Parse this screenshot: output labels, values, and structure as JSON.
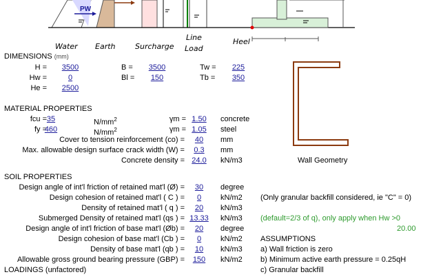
{
  "diagram": {
    "pw_label": "PW",
    "labels": {
      "water": "Water",
      "earth": "Earth",
      "surcharge": "Surcharge",
      "line_load_1": "Line",
      "line_load_2": "Load",
      "heel": "Heel"
    }
  },
  "dimensions": {
    "title": "DIMENSIONS",
    "unit": "(mm)",
    "H": {
      "label": "H =",
      "value": "3500"
    },
    "Hw": {
      "label": "Hw =",
      "value": "0"
    },
    "He": {
      "label": "He =",
      "value": "2500"
    },
    "B": {
      "label": "B =",
      "value": "3500"
    },
    "Bl": {
      "label": "Bl =",
      "value": "150"
    },
    "Tw": {
      "label": "Tw =",
      "value": "225"
    },
    "Tb": {
      "label": "Tb =",
      "value": "350"
    }
  },
  "material": {
    "title": "MATERIAL PROPERTIES",
    "fcu": {
      "label": "fcu =",
      "value": "35",
      "unit": "N/mm",
      "unit_sup": "2"
    },
    "fy": {
      "label": "fy =",
      "value": "460",
      "unit": "N/mm",
      "unit_sup": "2"
    },
    "gm_concrete": {
      "label": "γm =",
      "value": "1.50",
      "name": "concrete"
    },
    "gm_steel": {
      "label": "γm =",
      "value": "1.05",
      "name": "steel"
    },
    "cover": {
      "label": "Cover to tension reinforcement (co) =",
      "value": "40",
      "unit": "mm"
    },
    "crack": {
      "label": "Max. allowable design surface crack width (W) =",
      "value": "0.3",
      "unit": "mm"
    },
    "density": {
      "label": "Concrete density =",
      "value": "24.0",
      "unit": "kN/m3"
    },
    "wall_geometry_caption": "Wall Geometry"
  },
  "soil": {
    "title": "SOIL PROPERTIES",
    "rows": [
      {
        "label": "Design angle of int'l friction of retained mat'l (Ø) =",
        "value": "30",
        "unit": "degree"
      },
      {
        "label": "Design cohesion of retained mat'l ( C ) =",
        "value": "0",
        "unit": "kN/m2"
      },
      {
        "label": "Density of retained mat'l ( q ) =",
        "value": "20",
        "unit": "kN/m3"
      },
      {
        "label": "Submerged Density of retained mat'l (qs ) =",
        "value": "13.33",
        "unit": "kN/m3"
      },
      {
        "label": "Design angle of int'l friction of base mat'l (Øb) =",
        "value": "20",
        "unit": "degree"
      },
      {
        "label": "Design cohesion of base mat'l (Cb ) =",
        "value": "0",
        "unit": "kN/m2"
      },
      {
        "label": "Density of base mat'l (qb ) =",
        "value": "10",
        "unit": "kN/m3"
      },
      {
        "label": "Allowable gross ground bearing pressure (GBP) =",
        "value": "150",
        "unit": "kN/m2"
      }
    ],
    "note_granular": "(Only granular backfill considered, ie \"C\" = 0)",
    "note_default": "(default=2/3 of q), only apply when Hw >0",
    "note_value": "20.00",
    "assumptions_title": "ASSUMPTIONS",
    "assumption_a": "a) Wall friction is zero",
    "assumption_b": "b) Minimum active earth pressure = 0.25qH",
    "assumption_c": "c) Granular backfill"
  },
  "loadings": {
    "title": "LOADINGS (unfactored)"
  },
  "colors": {
    "link": "#1a1a9a",
    "green": "#2d9a2d",
    "wall": "#8b3a0f"
  }
}
